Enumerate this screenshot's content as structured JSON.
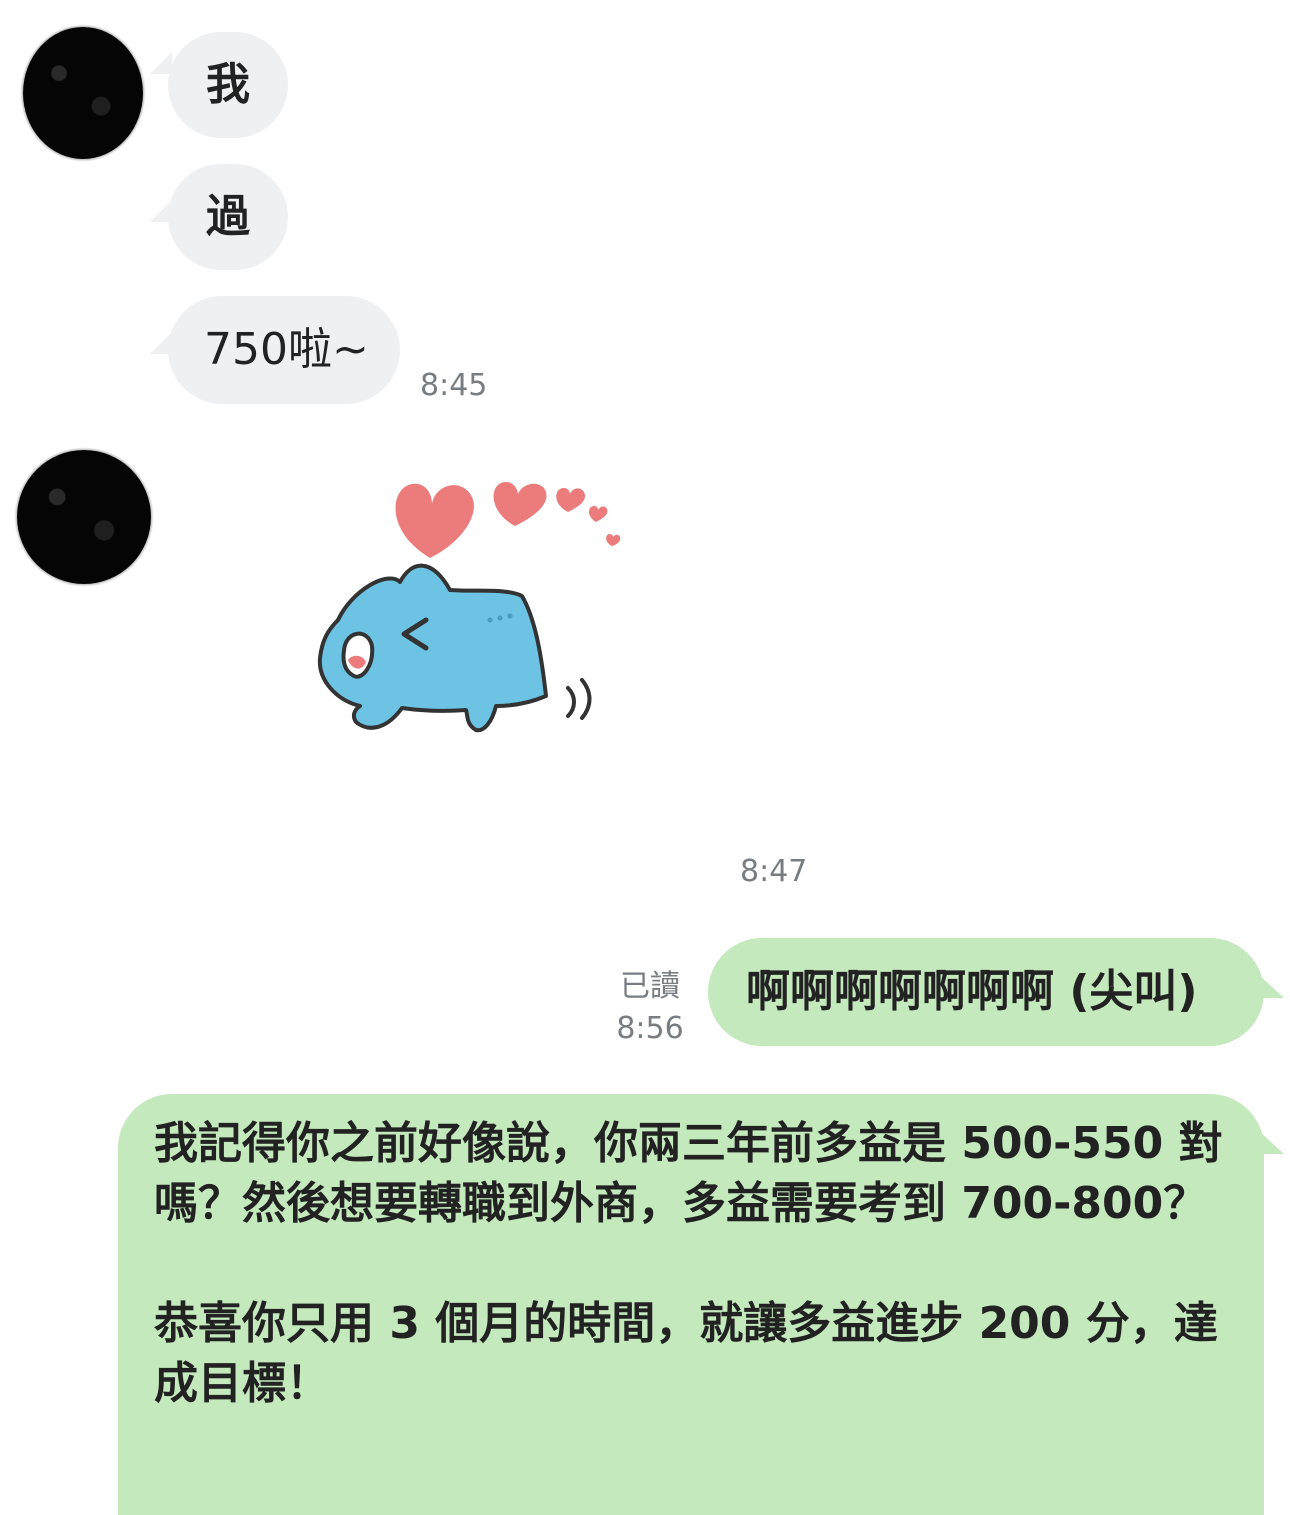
{
  "messages": {
    "m1": {
      "text": "我"
    },
    "m2": {
      "text": "過"
    },
    "m3": {
      "text": "750啦~",
      "time": "8:45"
    },
    "sticker": {
      "name": "blue-cat-hearts-sticker",
      "time": "8:47"
    },
    "m5": {
      "text": "啊啊啊啊啊啊啊 (尖叫)",
      "read": "已讀",
      "time": "8:56"
    },
    "m6": {
      "p1": "我記得你之前好像說，你兩三年前多益是 500-550 對嗎？然後想要轉職到外商，多益需要考到 700-800？",
      "p2": "恭喜你只用 3 個月的時間，就讓多益進步 200 分，達成目標！"
    }
  },
  "colors": {
    "incoming_bubble": "#eff0f2",
    "outgoing_bubble": "#c4e9bd",
    "timestamp": "#777d82",
    "sticker_body": "#6cc3e4",
    "hearts": "#ec7b7b"
  }
}
